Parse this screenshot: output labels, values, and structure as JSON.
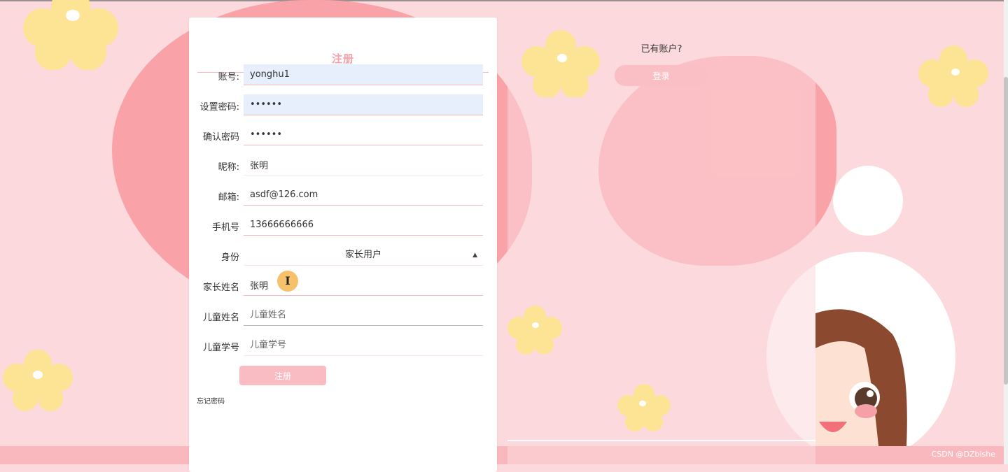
{
  "register": {
    "title": "注册",
    "fields": [
      {
        "label": "账号:",
        "value": "yonghu1",
        "placeholder": ""
      },
      {
        "label": "设置密码:",
        "value": "••••••",
        "placeholder": ""
      },
      {
        "label": "确认密码",
        "value": "••••••",
        "placeholder": ""
      },
      {
        "label": "昵称:",
        "value": "张明",
        "placeholder": ""
      },
      {
        "label": "邮箱:",
        "value": "asdf@126.com",
        "placeholder": ""
      },
      {
        "label": "手机号",
        "value": "13666666666",
        "placeholder": ""
      },
      {
        "label": "家长姓名",
        "value": "张明",
        "placeholder": ""
      },
      {
        "label": "儿童姓名",
        "value": "",
        "placeholder": "儿童姓名"
      },
      {
        "label": "儿童学号",
        "value": "",
        "placeholder": "儿童学号"
      }
    ],
    "role": {
      "label": "身份",
      "selected": "家长用户"
    },
    "submit_label": "注册",
    "forgot_label": "忘记密码"
  },
  "login": {
    "prompt": "已有账户?",
    "button_label": "登录"
  },
  "watermark": "CSDN @DZbishe",
  "colors": {
    "accent": "#f8bcc2",
    "title": "#f5a0a7",
    "background": "#fcd9dd",
    "blob": "#f9a3a8",
    "flower": "#fde394",
    "input_autofill": "#e6effb"
  },
  "icons": {
    "text_cursor": "text-cursor-icon",
    "select_arrow": "sort-arrows-icon"
  }
}
